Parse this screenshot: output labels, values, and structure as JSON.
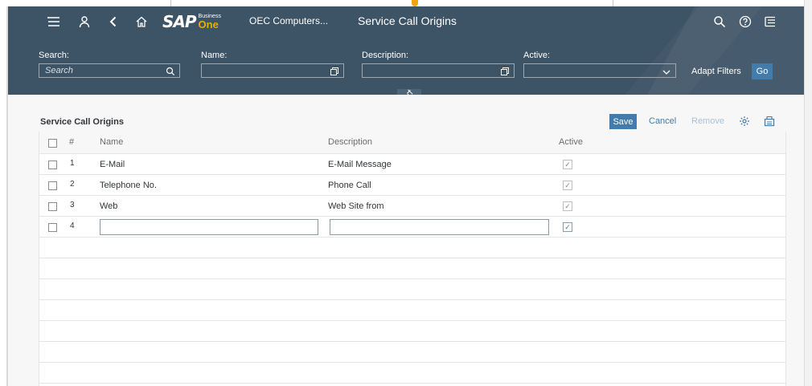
{
  "header": {
    "company": "OEC Computers...",
    "page_title": "Service Call Origins",
    "logo_text": "SAP",
    "logo_business": "Business",
    "logo_one": "One"
  },
  "filters": {
    "search_label": "Search:",
    "search_placeholder": "Search",
    "name_label": "Name:",
    "description_label": "Description:",
    "active_label": "Active:",
    "adapt_filters": "Adapt Filters",
    "go": "Go"
  },
  "table": {
    "title": "Service Call Origins",
    "toolbar": {
      "save": "Save",
      "cancel": "Cancel",
      "remove": "Remove"
    },
    "columns": {
      "num": "#",
      "name": "Name",
      "description": "Description",
      "active": "Active"
    },
    "rows": [
      {
        "num": "1",
        "name": "E-Mail",
        "description": "E-Mail Message",
        "active": true
      },
      {
        "num": "2",
        "name": "Telephone No.",
        "description": "Phone Call",
        "active": true
      },
      {
        "num": "3",
        "name": "Web",
        "description": "Web Site from",
        "active": true
      },
      {
        "num": "4",
        "name": "",
        "description": "",
        "active": true
      }
    ]
  },
  "colors": {
    "shell": "#3d5366",
    "accent": "#427cac",
    "logo_one": "#f0ab00"
  },
  "icons": [
    "menu-icon",
    "user-icon",
    "back-icon",
    "home-icon",
    "search-icon",
    "help-icon",
    "notifications-icon",
    "value-help-icon",
    "dropdown-icon",
    "pin-icon",
    "settings-icon",
    "export-icon"
  ]
}
